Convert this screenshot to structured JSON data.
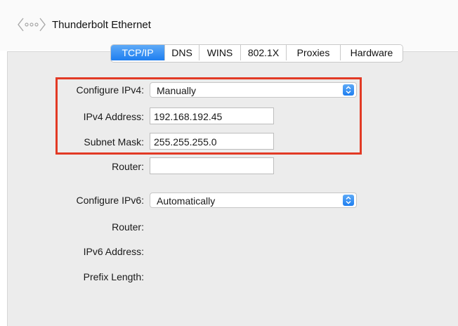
{
  "header": {
    "title": "Thunderbolt Ethernet",
    "icon": "network-dots-icon"
  },
  "tabs": [
    {
      "label": "TCP/IP",
      "active": true
    },
    {
      "label": "DNS",
      "active": false
    },
    {
      "label": "WINS",
      "active": false
    },
    {
      "label": "802.1X",
      "active": false
    },
    {
      "label": "Proxies",
      "active": false
    },
    {
      "label": "Hardware",
      "active": false
    }
  ],
  "ipv4": {
    "configure_label": "Configure IPv4:",
    "configure_value": "Manually",
    "address_label": "IPv4 Address:",
    "address_value": "192.168.192.45",
    "subnet_label": "Subnet Mask:",
    "subnet_value": "255.255.255.0",
    "router_label": "Router:",
    "router_value": ""
  },
  "ipv6": {
    "configure_label": "Configure IPv6:",
    "configure_value": "Automatically",
    "router_label": "Router:",
    "address_label": "IPv6 Address:",
    "prefix_label": "Prefix Length:"
  },
  "colors": {
    "accent": "#1e7ef0",
    "highlight": "#e23a25",
    "panel": "#ececec"
  }
}
